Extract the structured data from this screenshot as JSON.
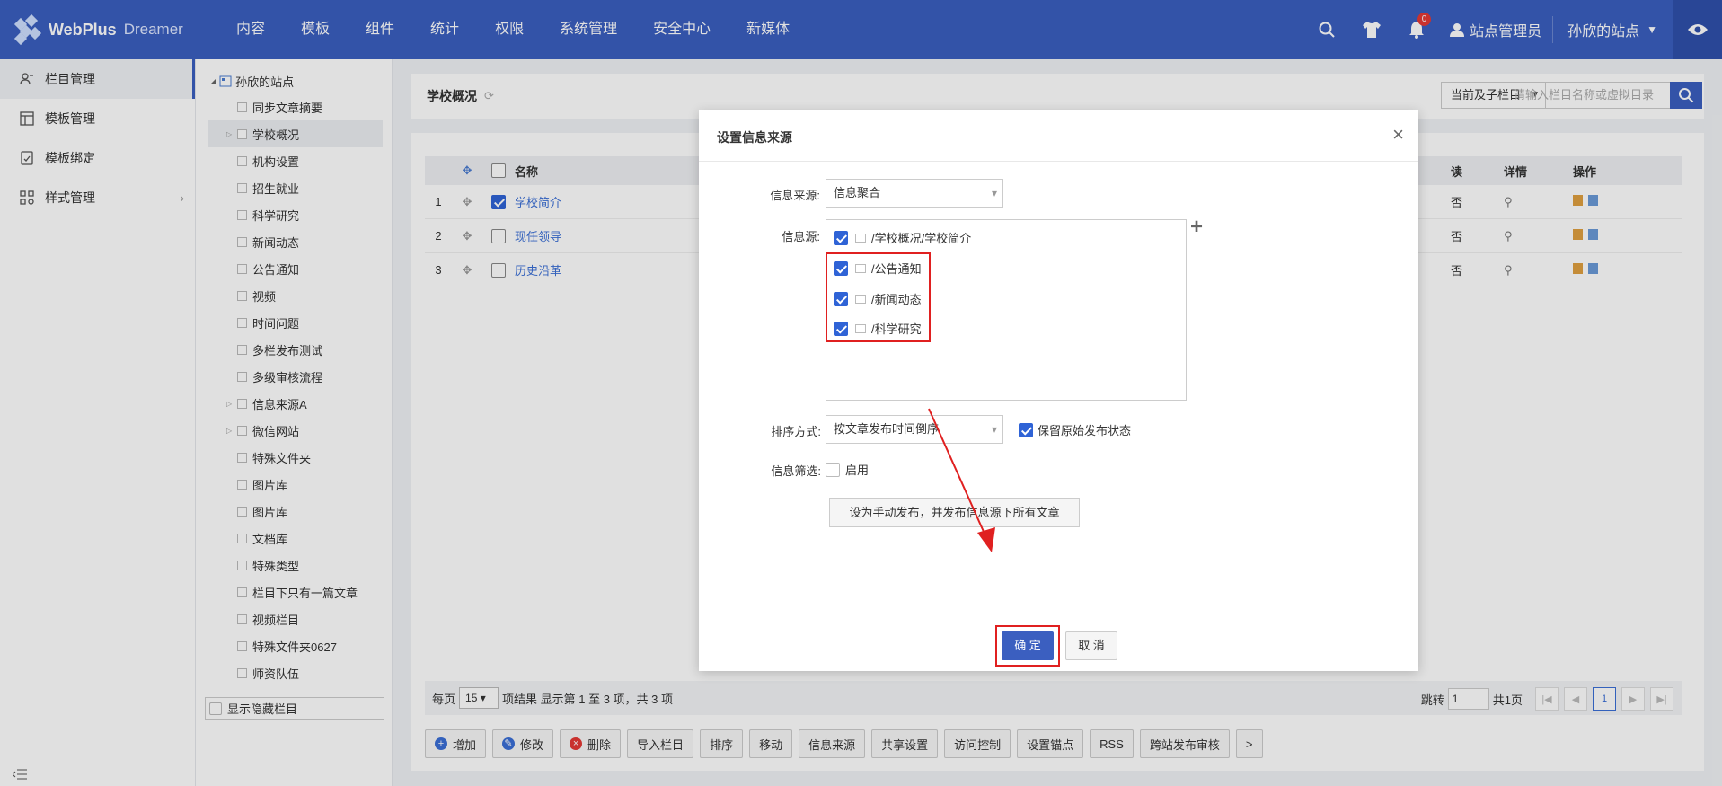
{
  "topbar": {
    "logo_text": "WebPlus",
    "logo_sub": "Dreamer",
    "nav": [
      "内容",
      "模板",
      "组件",
      "统计",
      "权限",
      "系统管理",
      "安全中心",
      "新媒体"
    ],
    "notification_count": "0",
    "user": "站点管理员",
    "site": "孙欣的站点"
  },
  "sidebar": {
    "items": [
      {
        "label": "栏目管理",
        "icon": "column-icon"
      },
      {
        "label": "模板管理",
        "icon": "template-icon"
      },
      {
        "label": "模板绑定",
        "icon": "bind-icon"
      },
      {
        "label": "样式管理",
        "icon": "style-icon"
      }
    ]
  },
  "tree": {
    "root": "孙欣的站点",
    "items": [
      "同步文章摘要",
      "学校概况",
      "机构设置",
      "招生就业",
      "科学研究",
      "新闻动态",
      "公告通知",
      "视频",
      "时间问题",
      "多栏发布测试",
      "多级审核流程",
      "信息来源A",
      "微信网站",
      "特殊文件夹",
      "图片库",
      "图片库",
      "文档库",
      "特殊类型",
      "栏目下只有一篇文章",
      "视频栏目",
      "特殊文件夹0627",
      "师资队伍"
    ],
    "show_hidden": "显示隐藏栏目"
  },
  "main": {
    "title": "学校概况",
    "filter": "当前及子栏目",
    "search_placeholder": "请输入栏目名称或虚拟目录",
    "table": {
      "headers": {
        "name": "名称",
        "col_read": "读",
        "col_detail": "详情",
        "col_ops": "操作"
      },
      "rows": [
        {
          "no": "1",
          "name": "学校简介",
          "checked": true,
          "read": "否"
        },
        {
          "no": "2",
          "name": "现任领导",
          "checked": false,
          "read": "否"
        },
        {
          "no": "3",
          "name": "历史沿革",
          "checked": false,
          "read": "否"
        }
      ]
    },
    "pager": {
      "per_page_label": "每页",
      "per_page": "15",
      "summary": "项结果 显示第 1 至 3 项，共 3 项",
      "jump_label": "跳转",
      "jump_value": "1",
      "total_pages": "共1页",
      "current": "1"
    },
    "actions": [
      {
        "label": "增加",
        "icon": "plus-circle-icon"
      },
      {
        "label": "修改",
        "icon": "edit-icon"
      },
      {
        "label": "删除",
        "icon": "delete-icon"
      },
      {
        "label": "导入栏目"
      },
      {
        "label": "排序"
      },
      {
        "label": "移动"
      },
      {
        "label": "信息来源"
      },
      {
        "label": "共享设置"
      },
      {
        "label": "访问控制"
      },
      {
        "label": "设置锚点"
      },
      {
        "label": "RSS"
      },
      {
        "label": "跨站发布审核"
      },
      {
        "label": ">"
      }
    ]
  },
  "dialog": {
    "title": "设置信息来源",
    "source_type_label": "信息来源:",
    "source_type_value": "信息聚合",
    "sources_label": "信息源:",
    "sources": [
      "/学校概况/学校简介",
      "/公告通知",
      "/新闻动态",
      "/科学研究"
    ],
    "sort_label": "排序方式:",
    "sort_value": "按文章发布时间倒序",
    "keep_status_label": "保留原始发布状态",
    "filter_label": "信息筛选:",
    "filter_enable": "启用",
    "manual_button": "设为手动发布，并发布信息源下所有文章",
    "ok": "确 定",
    "cancel": "取 消"
  },
  "colors": {
    "brand": "#3b5fc0",
    "link": "#3b6fd6",
    "highlight": "#e02020"
  }
}
